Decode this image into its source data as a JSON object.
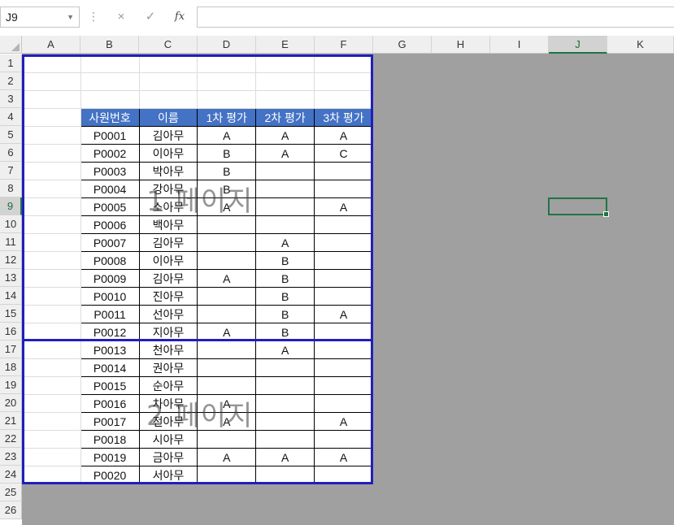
{
  "formula_bar": {
    "name_box": "J9",
    "cancel_icon": "×",
    "enter_icon": "✓",
    "fx_label": "fx",
    "formula": ""
  },
  "columns": [
    "A",
    "B",
    "C",
    "D",
    "E",
    "F",
    "G",
    "H",
    "I",
    "J",
    "K"
  ],
  "selected_column": "J",
  "rows": [
    "1",
    "2",
    "3",
    "4",
    "5",
    "6",
    "7",
    "8",
    "9",
    "10",
    "11",
    "12",
    "13",
    "14",
    "15",
    "16",
    "17",
    "18",
    "19",
    "20",
    "21",
    "22",
    "23",
    "24",
    "25",
    "26"
  ],
  "selected_row": "9",
  "table": {
    "headers": [
      "사원번호",
      "이름",
      "1차 평가",
      "2차 평가",
      "3차 평가"
    ],
    "rows": [
      [
        "P0001",
        "김아무",
        "A",
        "A",
        "A"
      ],
      [
        "P0002",
        "이아무",
        "B",
        "A",
        "C"
      ],
      [
        "P0003",
        "박아무",
        "B",
        "",
        ""
      ],
      [
        "P0004",
        "강아무",
        "B",
        "",
        ""
      ],
      [
        "P0005",
        "소아무",
        "A",
        "",
        "A"
      ],
      [
        "P0006",
        "백아무",
        "",
        "",
        ""
      ],
      [
        "P0007",
        "김아무",
        "",
        "A",
        ""
      ],
      [
        "P0008",
        "이아무",
        "",
        "B",
        ""
      ],
      [
        "P0009",
        "김아무",
        "A",
        "B",
        ""
      ],
      [
        "P0010",
        "진아무",
        "",
        "B",
        ""
      ],
      [
        "P0011",
        "선아무",
        "",
        "B",
        "A"
      ],
      [
        "P0012",
        "지아무",
        "A",
        "B",
        ""
      ],
      [
        "P0013",
        "천아무",
        "",
        "A",
        ""
      ],
      [
        "P0014",
        "권아무",
        "",
        "",
        ""
      ],
      [
        "P0015",
        "순아무",
        "",
        "",
        ""
      ],
      [
        "P0016",
        "차아무",
        "A",
        "",
        ""
      ],
      [
        "P0017",
        "전아무",
        "A",
        "",
        "A"
      ],
      [
        "P0018",
        "시아무",
        "",
        "",
        ""
      ],
      [
        "P0019",
        "금아무",
        "A",
        "A",
        "A"
      ],
      [
        "P0020",
        "서아무",
        "",
        "",
        ""
      ]
    ]
  },
  "watermarks": {
    "page1": "1 페이지",
    "page2": "2 페이지"
  },
  "colors": {
    "header_fill": "#4472c4",
    "page_border": "#1f1fbf",
    "selection": "#217346",
    "outside_print_area": "#a0a0a0"
  }
}
